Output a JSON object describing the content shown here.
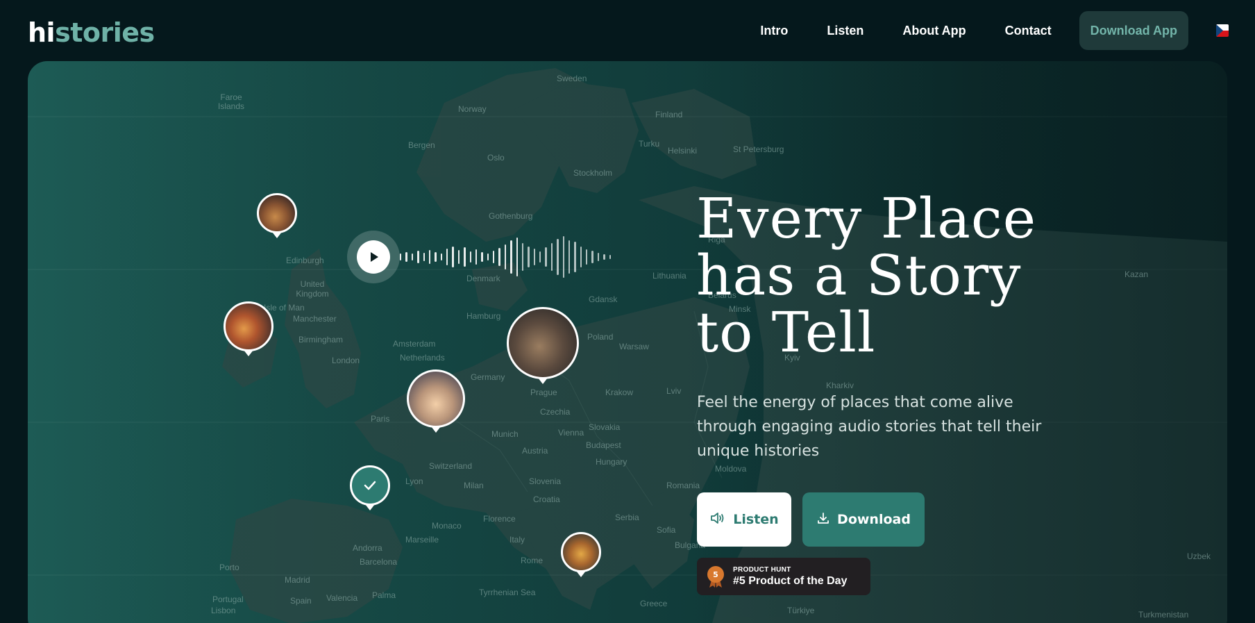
{
  "brand": {
    "logo_hi": "hi",
    "logo_rest": "stories"
  },
  "nav": {
    "links": [
      "Intro",
      "Listen",
      "About App",
      "Contact"
    ],
    "cta": "Download App",
    "language_flag": "czech-flag-icon"
  },
  "hero": {
    "headline": [
      "Every Place",
      "has a Story",
      "to Tell"
    ],
    "subtext": "Feel the energy of places that come alive through engaging audio stories that tell their unique histories",
    "listen_label": "Listen",
    "download_label": "Download",
    "product_hunt": {
      "small": "PRODUCT HUNT",
      "big": "#5 Product of the Day",
      "rank": "5"
    }
  },
  "map": {
    "labels": [
      "Faroe Islands",
      "Norway",
      "Sweden",
      "Finland",
      "Bergen",
      "Oslo",
      "Stockholm",
      "Turku",
      "Helsinki",
      "St Petersburg",
      "Edinburgh",
      "United Kingdom",
      "Isle of Man",
      "Manchester",
      "Birmingham",
      "London",
      "Gothenburg",
      "Denmark",
      "Hamburg",
      "Amsterdam",
      "Netherlands",
      "Germany",
      "Paris",
      "Prague",
      "Czechia",
      "Poland",
      "Warsaw",
      "Krakow",
      "Lithuania",
      "Gdansk",
      "Munich",
      "Vienna",
      "Slovakia",
      "Budapest",
      "Hungary",
      "Austria",
      "Switzerland",
      "Lyon",
      "Milan",
      "Slovenia",
      "Croatia",
      "Serbia",
      "Romania",
      "Sofia",
      "Bulgaria",
      "Monaco",
      "Florence",
      "Italy",
      "Rome",
      "Andorra",
      "Marseille",
      "Barcelona",
      "Madrid",
      "Spain",
      "Porto",
      "Portugal",
      "Lisbon",
      "Valencia",
      "Palma",
      "Tyrrhenian Sea",
      "Greece",
      "Türkiye",
      "Turkmenistan",
      "Belarus",
      "Kharkiv",
      "Riga",
      "Minsk",
      "Lviv",
      "Moldova",
      "Kyiv",
      "Uzbek",
      "Riga",
      "Kazan"
    ]
  }
}
